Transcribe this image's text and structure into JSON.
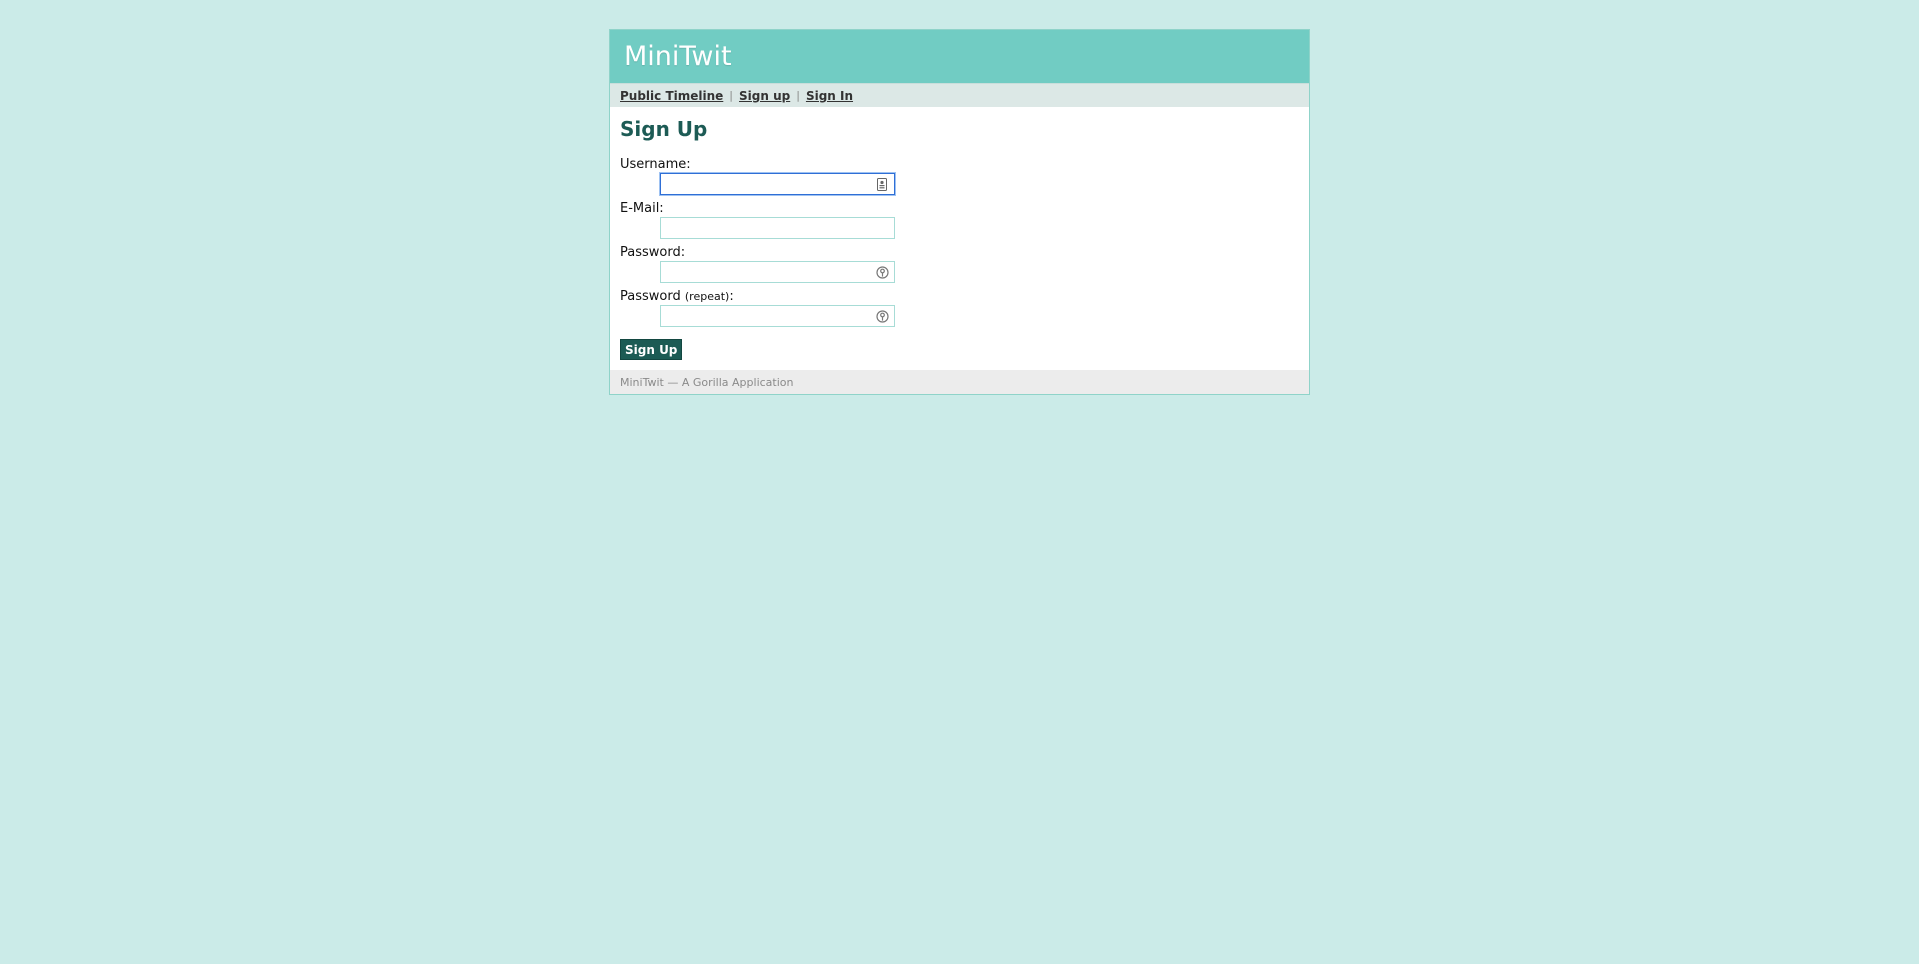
{
  "header": {
    "title": "MiniTwit"
  },
  "navigation": {
    "public_timeline": "Public Timeline",
    "sign_up": "Sign up",
    "sign_in": "Sign In",
    "separator": "|"
  },
  "main": {
    "title": "Sign Up",
    "fields": {
      "username": {
        "label": "Username:",
        "value": ""
      },
      "email": {
        "label": "E-Mail:",
        "value": ""
      },
      "password": {
        "label": "Password:",
        "value": ""
      },
      "password_repeat": {
        "label": "Password",
        "label_small": "(repeat)",
        "label_suffix": ":",
        "value": ""
      }
    },
    "submit_label": "Sign Up"
  },
  "footer": {
    "text": "MiniTwit — A Gorilla Application"
  },
  "colors": {
    "background": "#cbebe8",
    "header": "#71ccc3",
    "accent": "#1c5b54"
  },
  "icons": {
    "username_field": "contact-card-icon",
    "password_field": "key-icon"
  }
}
